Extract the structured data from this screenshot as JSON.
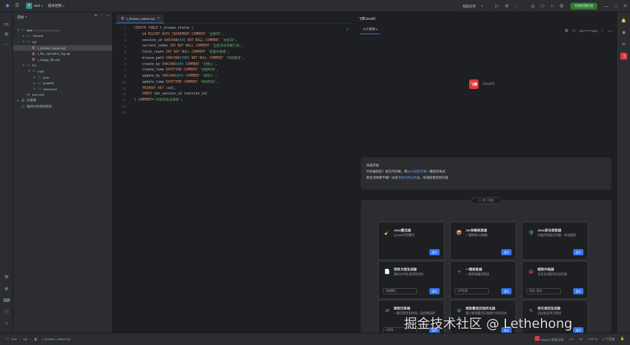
{
  "topbar": {
    "project_badge": "T",
    "project_name": "test",
    "vcs": "版本控制",
    "current_file": "当前文件",
    "run_button": "开始检测在线"
  },
  "project_panel": {
    "title": "项目",
    "tree": [
      {
        "label": "test",
        "path": "C:\\code\\ideaTest\\test",
        "indent": 0,
        "arrow": "▾",
        "icon": "folder",
        "selected": false
      },
      {
        "label": ".hexuan",
        "indent": 1,
        "arrow": "▸",
        "icon": "folder",
        "selected": false
      },
      {
        "label": "sql",
        "indent": 1,
        "arrow": "▾",
        "icon": "folder",
        "selected": false
      },
      {
        "label": "t_browse_status.sql",
        "indent": 2,
        "arrow": "",
        "icon": "sql",
        "selected": true
      },
      {
        "label": "t_file_operation_log.sql",
        "indent": 2,
        "arrow": "",
        "icon": "sql",
        "selected": false
      },
      {
        "label": "t_image_file.sql",
        "indent": 2,
        "arrow": "",
        "icon": "sql",
        "selected": false
      },
      {
        "label": "src",
        "indent": 1,
        "arrow": "▾",
        "icon": "folder",
        "selected": false
      },
      {
        "label": "main",
        "indent": 2,
        "arrow": "▾",
        "icon": "folder",
        "selected": false
      },
      {
        "label": "java",
        "indent": 3,
        "arrow": "▸",
        "icon": "folder",
        "selected": false
      },
      {
        "label": "javatest",
        "indent": 3,
        "arrow": "▸",
        "icon": "folder",
        "selected": false
      },
      {
        "label": "resources",
        "indent": 3,
        "arrow": "▸",
        "icon": "folder",
        "selected": false
      },
      {
        "label": "pom.xml",
        "indent": 1,
        "arrow": "",
        "icon": "xml",
        "selected": false
      },
      {
        "label": "外部库",
        "indent": 0,
        "arrow": "▸",
        "icon": "lib",
        "selected": false
      },
      {
        "label": "临时文件和控制台",
        "indent": 0,
        "arrow": "",
        "icon": "scratch",
        "selected": false
      }
    ]
  },
  "editor": {
    "tab_label": "t_browse_status.sql",
    "line_count": 15
  },
  "ai_panel": {
    "title": "飞算JavaAI",
    "tab_label": "AI工程师",
    "user": "187*****7630",
    "logo_mark": "飞算",
    "logo_text": "JavaAI",
    "quick_start": {
      "title": "快速开始",
      "line1_prefix": "代码难改乱？提交代码略，用",
      "line1_hl": "Java智能引擎",
      "line1_suffix": "一键规范格式",
      "line2_prefix": "新生项目看不懂？试试",
      "line2_hl": "项目文档分析器",
      "line2_suffix": "，快速搭建架构内容"
    },
    "features_pill": "热门功能",
    "cards": [
      {
        "name": "Java整洁器",
        "desc": "让Java代码整洁",
        "icon": "🧹",
        "use": "运行"
      },
      {
        "name": "Jar依赖修复器",
        "desc": "一键修复Jar依赖",
        "icon": "📦",
        "use": "运行"
      },
      {
        "name": "Java安全修复器",
        "desc": "扫描代码安全问题，并发漏洞",
        "icon": "🛡",
        "use": "运行"
      },
      {
        "name": "项目文档生成器",
        "desc": "源码分析生成项目文档",
        "icon": "📄",
        "use": "运行",
        "select": "快速模式"
      },
      {
        "name": "一键修复器",
        "desc": "一键修复编译错误",
        "icon": "＋",
        "use": "运行",
        "select": "AI专业版"
      },
      {
        "name": "框架升级器",
        "desc": "支持主流框架自动升级",
        "icon": "🐞",
        "use": "运行",
        "select": "框架 | 版本"
      },
      {
        "name": "框架迁移器",
        "desc": "一键迁移老旧代码，前后端选择",
        "icon": "⇄",
        "use": "运行",
        "select": "从框架..."
      },
      {
        "name": "框架最佳实践优化器",
        "desc": "基于框架最佳实践进行代码优化",
        "icon": "⊞",
        "use": "运行"
      },
      {
        "name": "单元测试生成器",
        "desc": "自动生成单元测试",
        "icon": "✎",
        "use": "运行"
      }
    ]
  },
  "status_bar": {
    "crumbs": [
      "test",
      "sql",
      "t_browse_status.sql"
    ],
    "ai_name": "JavaAI",
    "ai_status": "智能分析",
    "right_items": [
      "1:1",
      "LF",
      "UTF-8",
      "4 个空格"
    ]
  },
  "watermark": "掘金技术社区 @ Lethehong",
  "colors": {
    "accent": "#3574f0",
    "ai_brand": "#e0393e",
    "run": "#2e7d32"
  }
}
